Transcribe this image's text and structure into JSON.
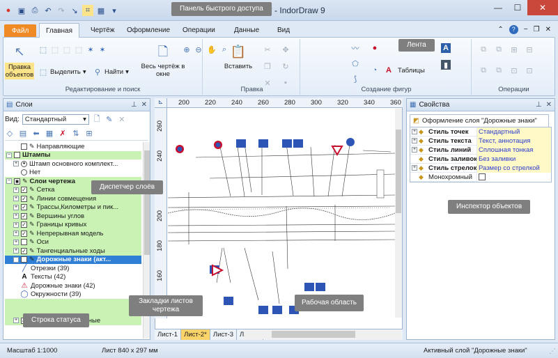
{
  "window": {
    "title": "000.rdw * - IndorDraw 9",
    "minimize": "—",
    "maximize": "☐",
    "close": "✕"
  },
  "qat": [
    "save",
    "print",
    "undo",
    "redo",
    "select",
    "snap",
    "grid",
    "menu"
  ],
  "tabs": {
    "file": "Файл",
    "items": [
      "Главная",
      "Чертёж",
      "Оформление",
      "Операции",
      "Данные",
      "Вид"
    ]
  },
  "ribbon": {
    "edit_select": {
      "edit_objects": "Правка объектов",
      "select": "Выделить",
      "find": "Найти",
      "whole_drawing": "Весь чертёж в окне",
      "label": "Редактирование и поиск"
    },
    "clipboard": {
      "paste": "Вставить",
      "label": "Правка"
    },
    "shapes": {
      "tables": "Таблицы",
      "label": "Создание фигур"
    },
    "operations": {
      "label": "Операции"
    }
  },
  "layers": {
    "title": "Слои",
    "view_label": "Вид:",
    "view_value": "Стандартный",
    "items": [
      {
        "label": "Направляющие",
        "indent": 1,
        "exp": "",
        "cb": "",
        "pen": true,
        "bg": ""
      },
      {
        "label": "Штампы",
        "indent": 0,
        "exp": "−",
        "cb": "",
        "pen": false,
        "bg": "g",
        "bold": true
      },
      {
        "label": "Штамп основного комплект...",
        "indent": 1,
        "exp": "+",
        "cb": "radio-on",
        "pen": false,
        "bg": ""
      },
      {
        "label": "Нет",
        "indent": 1,
        "exp": "",
        "cb": "radio",
        "pen": false,
        "bg": ""
      },
      {
        "label": "Слои чертежа",
        "indent": 0,
        "exp": "−",
        "cb": "■",
        "pen": true,
        "bg": "g",
        "bold": true
      },
      {
        "label": "Сетка",
        "indent": 1,
        "exp": "+",
        "cb": "✓",
        "pen": true,
        "bg": "g"
      },
      {
        "label": "Линии совмещения",
        "indent": 1,
        "exp": "+",
        "cb": "✓",
        "pen": true,
        "bg": "g"
      },
      {
        "label": "Трассы,Километры и пик...",
        "indent": 1,
        "exp": "+",
        "cb": "✓",
        "pen": true,
        "bg": "g"
      },
      {
        "label": "Вершины углов",
        "indent": 1,
        "exp": "+",
        "cb": "✓",
        "pen": true,
        "bg": "g"
      },
      {
        "label": "Границы кривых",
        "indent": 1,
        "exp": "+",
        "cb": "✓",
        "pen": true,
        "bg": "g"
      },
      {
        "label": "Непрерывная модель",
        "indent": 1,
        "exp": "+",
        "cb": "✓",
        "pen": true,
        "bg": "g"
      },
      {
        "label": "Оси",
        "indent": 1,
        "exp": "+",
        "cb": "",
        "pen": true,
        "bg": "g"
      },
      {
        "label": "Тангенциальные ходы",
        "indent": 1,
        "exp": "+",
        "cb": "✓",
        "pen": true,
        "bg": "g"
      },
      {
        "label": "Дорожные знаки (акт...",
        "indent": 1,
        "exp": "−",
        "cb": "✓",
        "pen": true,
        "bg": "hl",
        "bold": true
      },
      {
        "label": "Отрезки (39)",
        "indent": 2,
        "exp": "",
        "cb": "",
        "pen": false,
        "bg": "",
        "icon": "line"
      },
      {
        "label": "Тексты (42)",
        "indent": 2,
        "exp": "",
        "cb": "",
        "pen": false,
        "bg": "",
        "icon": "A"
      },
      {
        "label": "Дорожные знаки (42)",
        "indent": 2,
        "exp": "",
        "cb": "",
        "pen": false,
        "bg": "",
        "icon": "sign"
      },
      {
        "label": "Окружности (39)",
        "indent": 2,
        "exp": "",
        "cb": "",
        "pen": false,
        "bg": "",
        "icon": "circle"
      },
      {
        "label": "",
        "indent": 1,
        "exp": "",
        "cb": "",
        "pen": false,
        "bg": "g"
      },
      {
        "label": "",
        "indent": 1,
        "exp": "",
        "cb": "",
        "pen": false,
        "bg": "g"
      },
      {
        "label": "Точечные ...ционные",
        "indent": 1,
        "exp": "+",
        "cb": "✓",
        "pen": true,
        "bg": "g"
      }
    ]
  },
  "ruler": {
    "top": [
      "200",
      "220",
      "240",
      "260",
      "280",
      "300",
      "320",
      "340",
      "360"
    ],
    "left": [
      "260",
      "240",
      "220",
      "200",
      "180",
      "160",
      "140"
    ]
  },
  "sheets": [
    "Лист-1",
    "Лист-2*",
    "Лист-3",
    "Лист-4"
  ],
  "properties": {
    "title": "Свойства",
    "tab": "Оформление слоя \"Дорожные знаки\"",
    "rows": [
      {
        "key": "Стиль точек",
        "value": "Стандартный",
        "exp": "+"
      },
      {
        "key": "Стиль текста",
        "value": "Текст, аннотация",
        "exp": "+"
      },
      {
        "key": "Стиль линий",
        "value": "Сплошная тонкая",
        "exp": "+"
      },
      {
        "key": "Стиль заливок",
        "value": "Без заливки",
        "exp": ""
      },
      {
        "key": "Стиль стрелок",
        "value": "Размер со стрелкой",
        "exp": "+"
      },
      {
        "key": "Монохромный",
        "value": "",
        "exp": "",
        "plain": true
      }
    ]
  },
  "status": {
    "scale": "Масштаб 1:1000",
    "sheet": "Лист 840 x 297 мм",
    "active_layer": "Активный слой \"Дорожные знаки\""
  },
  "callouts": {
    "qat": "Панель быстрого доступа",
    "ribbon": "Лента",
    "layers": "Диспетчер слоёв",
    "inspector": "Инспектор объектов",
    "work": "Рабочая область",
    "sheets": "Закладки листов чертежа",
    "status": "Строка статуса"
  }
}
